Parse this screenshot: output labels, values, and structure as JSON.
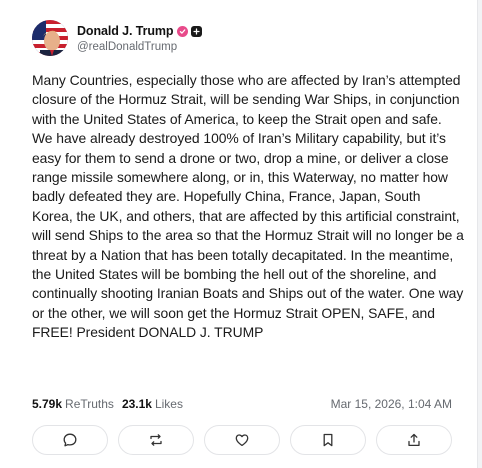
{
  "post": {
    "author": {
      "display_name": "Donald J. Trump",
      "handle": "@realDonaldTrump",
      "verified_icon": "verified-badge-icon",
      "subscriber_icon": "plus-badge-icon"
    },
    "text": "Many Countries, especially those who are affected by Iran’s attempted closure of the Hormuz Strait, will be sending War Ships, in conjunction with the United States of America, to keep the Strait open and safe. We have already destroyed 100% of Iran’s Military capability, but it’s easy for them to send a drone or two, drop a mine, or deliver a close range missile somewhere along, or in, this Waterway, no matter how badly defeated they are. Hopefully China, France, Japan, South Korea, the UK, and others, that are affected by this artificial constraint, will send Ships to the area so that the Hormuz Strait will no longer be a threat by a Nation that has been totally decapitated. In the meantime, the United States will be bombing the hell out of the shoreline, and continually shooting Iranian Boats and Ships out of the water. One way or the other, we will soon get the Hormuz Strait OPEN, SAFE, and FREE! President DONALD J. TRUMP",
    "stats": {
      "retruths_count": "5.79k",
      "retruths_label": "ReTruths",
      "likes_count": "23.1k",
      "likes_label": "Likes"
    },
    "timestamp": "Mar 15, 2026, 1:04 AM"
  },
  "actions": [
    {
      "name": "reply",
      "icon": "reply-icon"
    },
    {
      "name": "retruth",
      "icon": "retruth-icon"
    },
    {
      "name": "like",
      "icon": "heart-icon"
    },
    {
      "name": "bookmark",
      "icon": "bookmark-icon"
    },
    {
      "name": "share",
      "icon": "share-icon"
    }
  ],
  "colors": {
    "verified_badge": "#e84a8a",
    "secondary_text": "#666a70",
    "primary_text": "#111111",
    "border": "#e3e4e7"
  }
}
